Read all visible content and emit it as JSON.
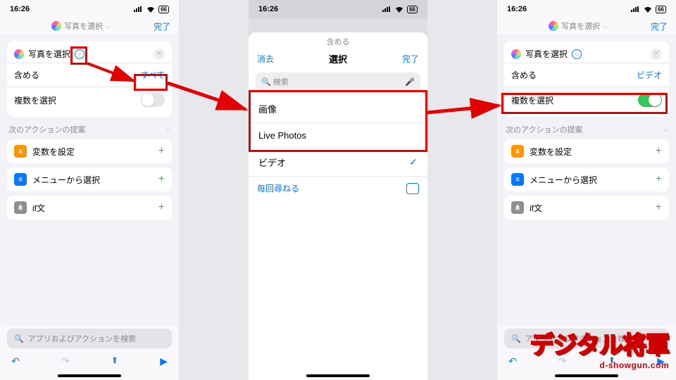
{
  "status": {
    "time": "16:26",
    "battery": "66"
  },
  "nav": {
    "title_text": "写真を選択",
    "done": "完了"
  },
  "action": {
    "title": "写真を選択",
    "include_label": "含める",
    "include_value_all": "すべて",
    "include_value_video": "ビデオ",
    "multi_label": "複数を選択"
  },
  "suggest_header": "次のアクションの提案",
  "suggest": {
    "set_var": "変数を設定",
    "menu": "メニューから選択",
    "if": "if文"
  },
  "search_placeholder": "アプリおよびアクションを検索",
  "sheet": {
    "overline": "含める",
    "clear": "消去",
    "title": "選択",
    "done": "完了",
    "search": "検索",
    "opt_image": "画像",
    "opt_live": "Live Photos",
    "opt_video": "ビデオ",
    "ask_each": "毎回尋ねる"
  },
  "logo_text": "デジタル将軍",
  "logo_sub": "d-showgun.com"
}
